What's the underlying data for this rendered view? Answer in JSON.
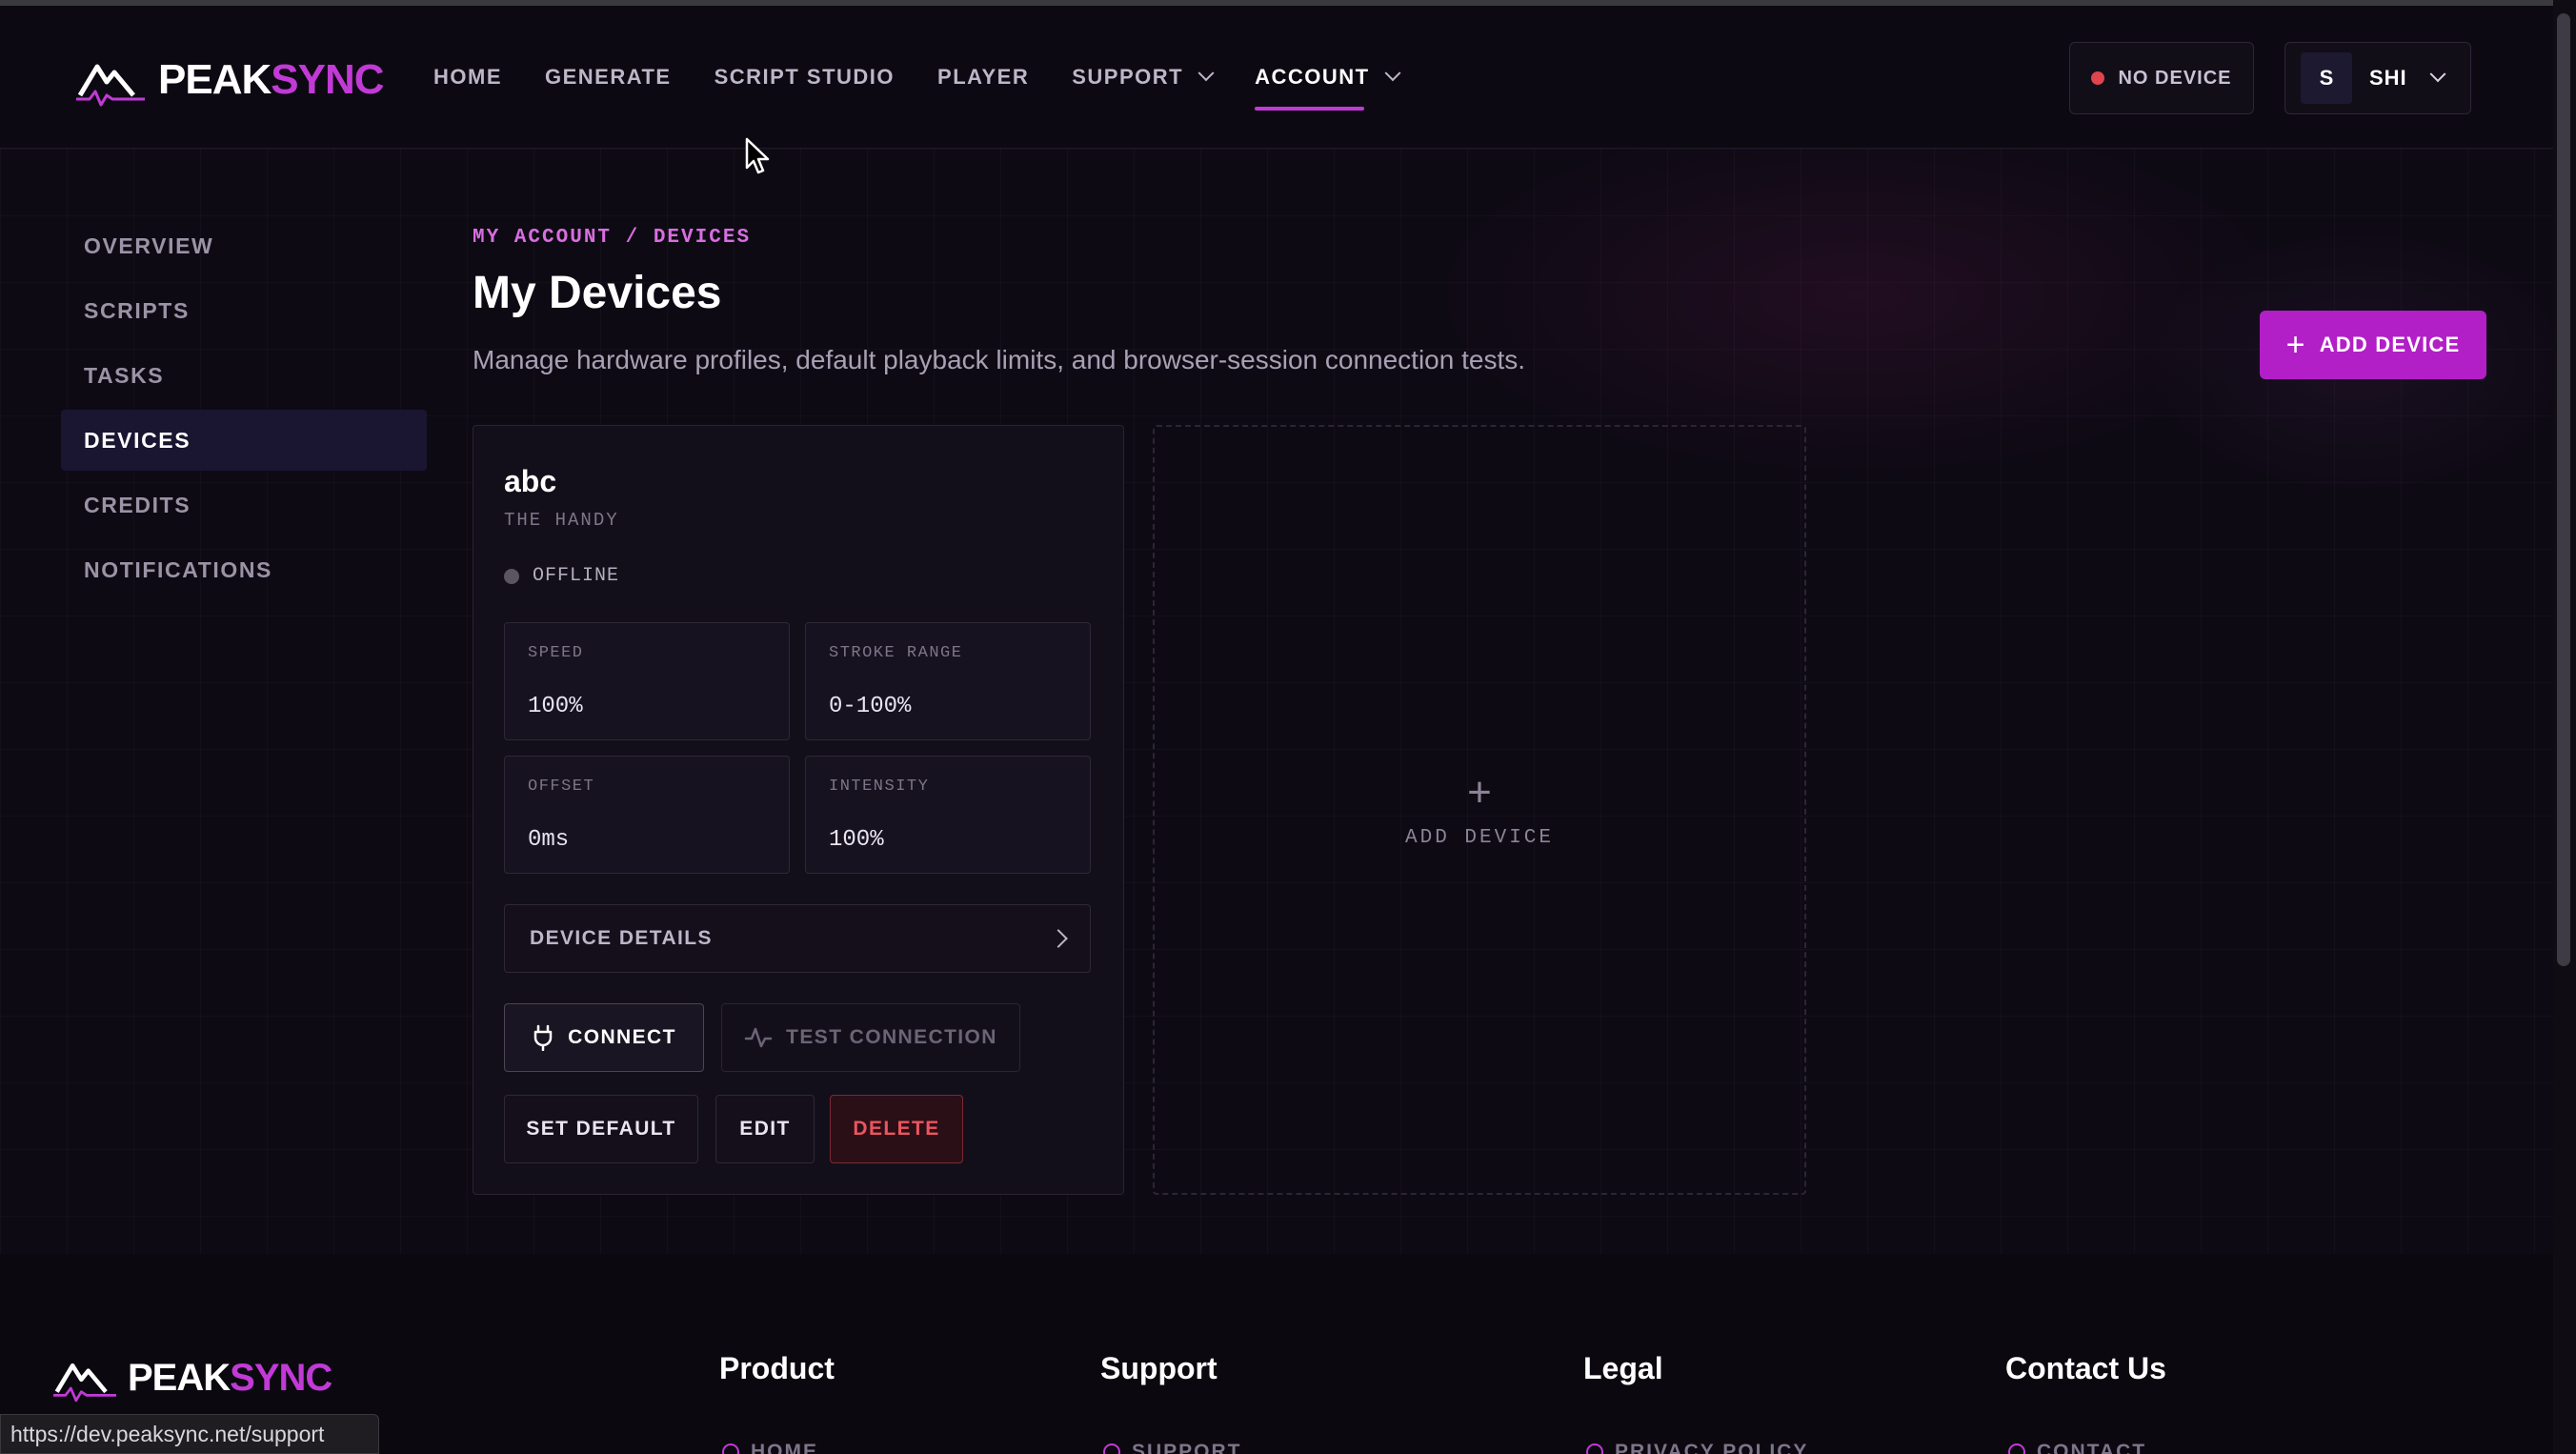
{
  "brand": {
    "part1": "PEAK",
    "part2": "SYNC"
  },
  "nav": {
    "items": [
      {
        "label": "HOME"
      },
      {
        "label": "GENERATE"
      },
      {
        "label": "SCRIPT STUDIO"
      },
      {
        "label": "PLAYER"
      },
      {
        "label": "SUPPORT"
      },
      {
        "label": "ACCOUNT"
      }
    ],
    "device_status": "NO DEVICE",
    "user_initial": "S",
    "user_name": "SHI"
  },
  "sidebar": {
    "items": [
      {
        "label": "OVERVIEW"
      },
      {
        "label": "SCRIPTS"
      },
      {
        "label": "TASKS"
      },
      {
        "label": "DEVICES"
      },
      {
        "label": "CREDITS"
      },
      {
        "label": "NOTIFICATIONS"
      }
    ]
  },
  "main": {
    "breadcrumb": "MY ACCOUNT / DEVICES",
    "title": "My Devices",
    "subtitle": "Manage hardware profiles, default playback limits, and browser-session connection tests.",
    "add_button": "ADD DEVICE"
  },
  "device": {
    "name": "abc",
    "type": "THE HANDY",
    "status": "OFFLINE",
    "stats": [
      {
        "label": "SPEED",
        "value": "100%"
      },
      {
        "label": "STROKE RANGE",
        "value": "0-100%"
      },
      {
        "label": "OFFSET",
        "value": "0ms"
      },
      {
        "label": "INTENSITY",
        "value": "100%"
      }
    ],
    "details_label": "DEVICE DETAILS",
    "connect_label": "CONNECT",
    "test_label": "TEST CONNECTION",
    "set_default_label": "SET DEFAULT",
    "edit_label": "EDIT",
    "delete_label": "DELETE"
  },
  "add_card": {
    "label": "ADD DEVICE"
  },
  "footer": {
    "columns": [
      "Product",
      "Support",
      "Legal",
      "Contact Us"
    ],
    "links": [
      "HOME",
      "SUPPORT",
      "PRIVACY POLICY",
      "CONTACT"
    ]
  },
  "status_url": "https://dev.peaksync.net/support",
  "colors": {
    "accent": "#c13ad6",
    "button": "#b21fc7",
    "danger": "#ea5560"
  }
}
